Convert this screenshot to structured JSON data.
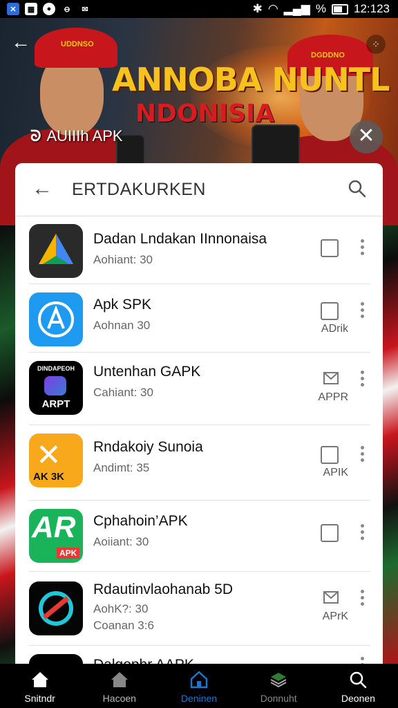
{
  "status_bar": {
    "time": "12:123",
    "battery": "%"
  },
  "banner": {
    "title": "ANNOBA NUNTL",
    "subtitle": "NDONISIA",
    "cap_text_left": "UDDNSO",
    "cap_text_right": "DGDDNO",
    "brand": "AUIIIh APK"
  },
  "search": {
    "query": "ERTDAKURKEN"
  },
  "apps": [
    {
      "name": "Dadan Lndakan IInnonaisa",
      "meta": [
        "Aohiant: 30"
      ],
      "action": ""
    },
    {
      "name": "Apk SPK",
      "meta": [
        "Aohnan 30"
      ],
      "action": "ADrik"
    },
    {
      "name": "Untenhan GAPK",
      "meta": [
        "Cahiant: 30"
      ],
      "action": "APPR"
    },
    {
      "name": "Rndakoiy Sunoia",
      "meta": [
        "Andimt: 35"
      ],
      "action": "APIK"
    },
    {
      "name": "Cphahoin’APK",
      "meta": [
        "Aoiiant: 30"
      ],
      "action": ""
    },
    {
      "name": "Rdautinvlaohanab 5D",
      "meta": [
        "AohK?: 30",
        "Coanan 3:6"
      ],
      "action": "APrK"
    },
    {
      "name": "Dalgophr AAPK",
      "meta": [],
      "action": ""
    }
  ],
  "icon_text": {
    "app3_top": "DINDAPEOH",
    "app3_bottom": "ARPT",
    "app4_bottom": "AK 3K",
    "app5_main": "AR",
    "app5_badge": "APK"
  },
  "nav": [
    {
      "label": "Snitndr",
      "active": false
    },
    {
      "label": "Hacoen",
      "active": false
    },
    {
      "label": "Deninen",
      "active": true
    },
    {
      "label": "Donnuht",
      "active": false
    },
    {
      "label": "Deonen",
      "active": false
    }
  ],
  "colors": {
    "accent": "#1976d2",
    "red": "#c8161d",
    "gold": "#f7c21d"
  }
}
